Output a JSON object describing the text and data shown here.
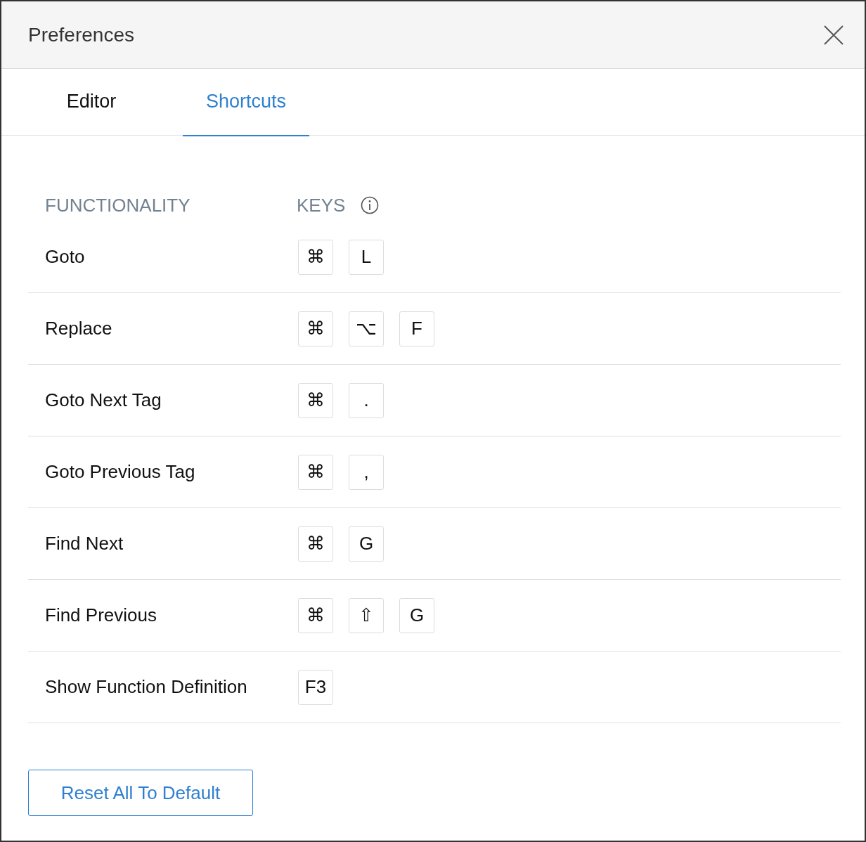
{
  "window": {
    "title": "Preferences"
  },
  "tabs": [
    {
      "label": "Editor",
      "selected": false
    },
    {
      "label": "Shortcuts",
      "selected": true
    }
  ],
  "table": {
    "columns": [
      "FUNCTIONALITY",
      "KEYS"
    ],
    "rows": [
      {
        "name": "Goto",
        "keys": [
          "⌘",
          "L"
        ]
      },
      {
        "name": "Replace",
        "keys": [
          "⌘",
          "⌥",
          "F"
        ]
      },
      {
        "name": "Goto Next Tag",
        "keys": [
          "⌘",
          "."
        ]
      },
      {
        "name": "Goto Previous Tag",
        "keys": [
          "⌘",
          ","
        ]
      },
      {
        "name": "Find Next",
        "keys": [
          "⌘",
          "G"
        ]
      },
      {
        "name": "Find Previous",
        "keys": [
          "⌘",
          "⇧",
          "G"
        ]
      },
      {
        "name": "Show Function Definition",
        "keys": [
          "F3"
        ]
      }
    ]
  },
  "reset_button": "Reset All To Default"
}
